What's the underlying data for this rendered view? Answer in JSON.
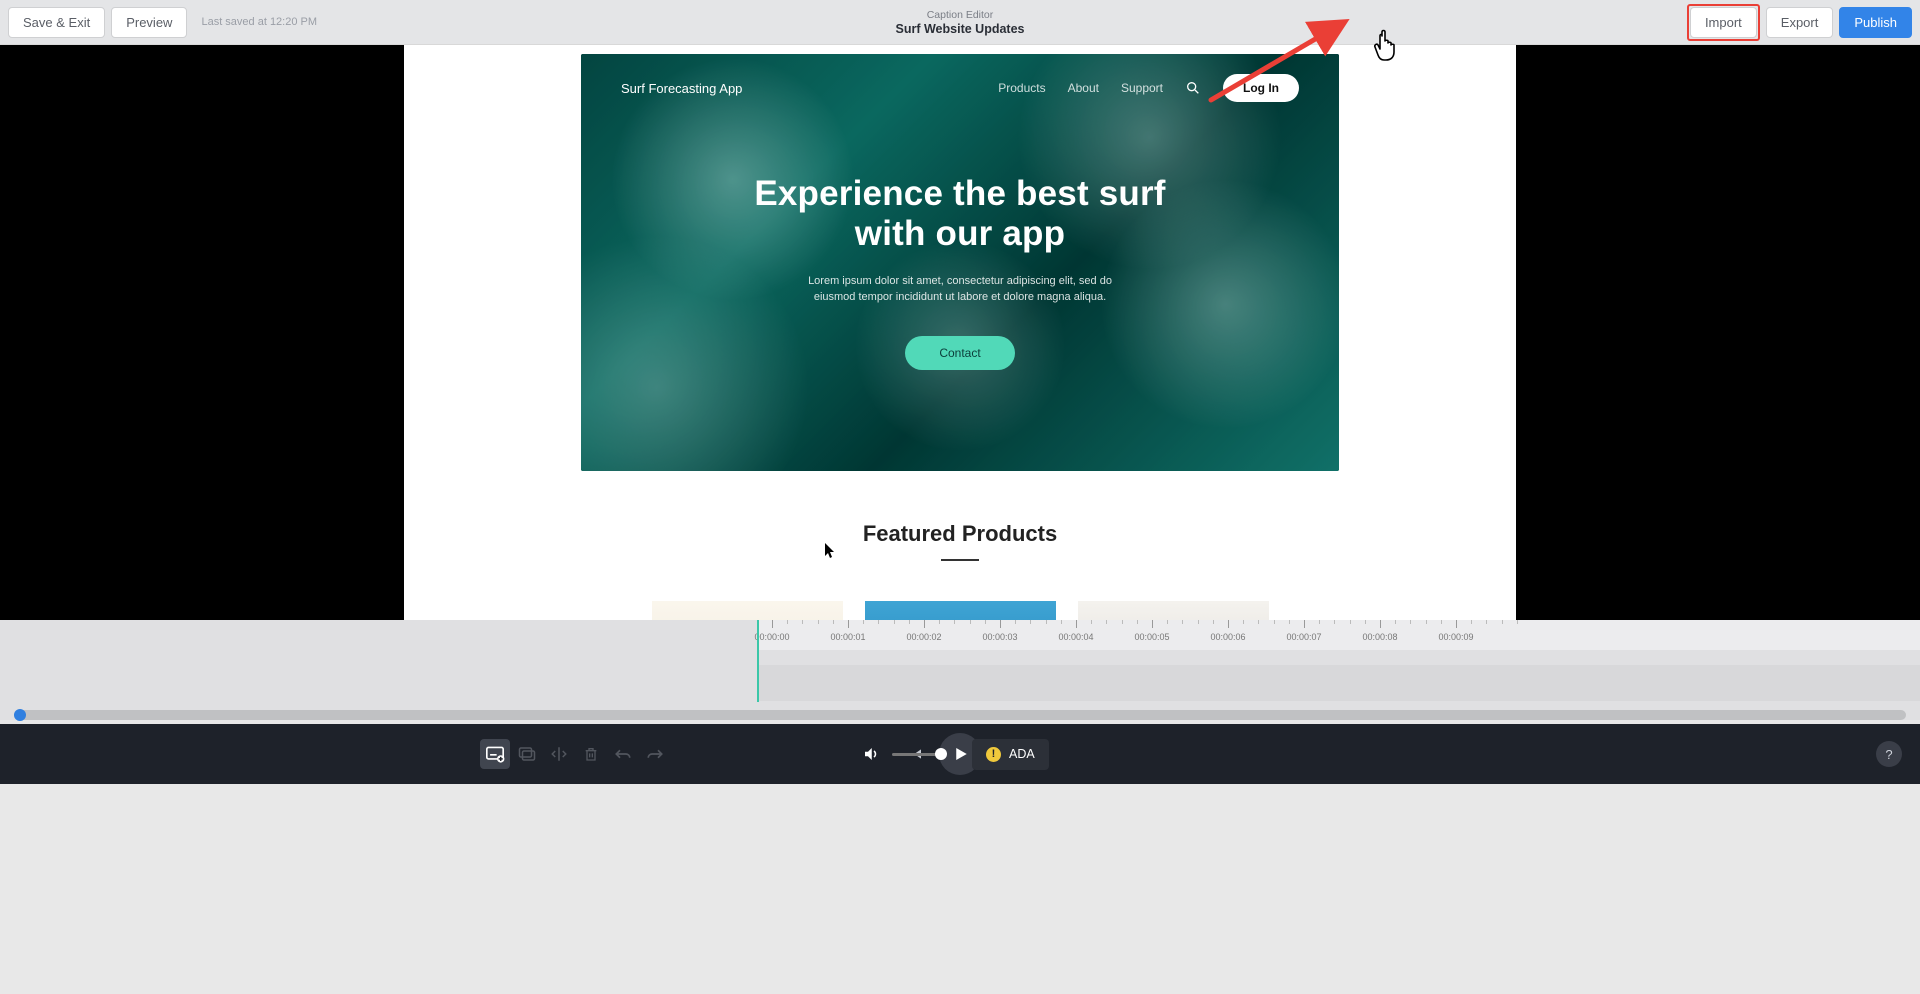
{
  "header": {
    "save_exit": "Save & Exit",
    "preview": "Preview",
    "last_saved": "Last saved at 12:20 PM",
    "subtitle": "Caption Editor",
    "title": "Surf Website Updates",
    "import": "Import",
    "export": "Export",
    "publish": "Publish"
  },
  "website": {
    "brand": "Surf Forecasting App",
    "nav": {
      "products": "Products",
      "about": "About",
      "support": "Support"
    },
    "login": "Log In",
    "hero_line1": "Experience the best surf",
    "hero_line2": "with our app",
    "hero_sub1": "Lorem ipsum dolor sit amet, consectetur adipiscing elit, sed do",
    "hero_sub2": "eiusmod tempor incididunt ut labore et dolore magna aliqua.",
    "cta": "Contact",
    "featured": "Featured Products"
  },
  "timeline": {
    "labels": [
      "00:00:00",
      "00:00:01",
      "00:00:02",
      "00:00:03",
      "00:00:04",
      "00:00:05",
      "00:00:06",
      "00:00:07",
      "00:00:08",
      "00:00:09"
    ]
  },
  "controls": {
    "ada_label": "ADA",
    "ada_warning_glyph": "!",
    "help": "?"
  },
  "anno": {
    "arrow_color": "#ea3f36"
  }
}
